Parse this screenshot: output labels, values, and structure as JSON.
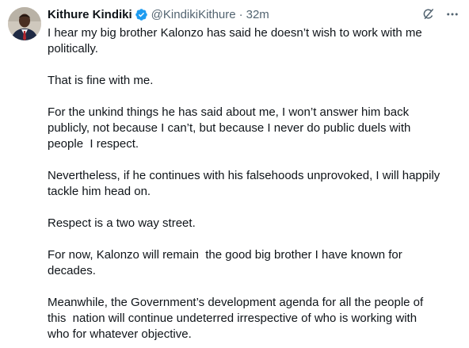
{
  "author": {
    "name": "Kithure Kindiki",
    "handle": "@KindikiKithure",
    "separator": "·",
    "time": "32m"
  },
  "colors": {
    "text": "#0f1419",
    "secondary": "#536471",
    "verified": "#1d9bf0"
  },
  "icons": {
    "verified": "verified-badge-icon",
    "grok": "grok-icon",
    "more": "more-options-icon"
  },
  "tweet": {
    "paragraphs": [
      "I hear my big brother Kalonzo has said he doesn’t wish to work with me\npolitically.",
      "That is fine with me.",
      "For the unkind things he has said about me, I won’t answer him back\npublicly, not because I can’t, but because I never do public duels with\npeople  I respect.",
      "Nevertheless, if he continues with his falsehoods unprovoked, I will happily\ntackle him head on.",
      "Respect is a two way street.",
      "For now, Kalonzo will remain  the good big brother I have known for\ndecades.",
      "Meanwhile, the Government’s development agenda for all the people of\nthis  nation will continue undeterred irrespective of who is working with\nwho for whatever objective."
    ]
  }
}
